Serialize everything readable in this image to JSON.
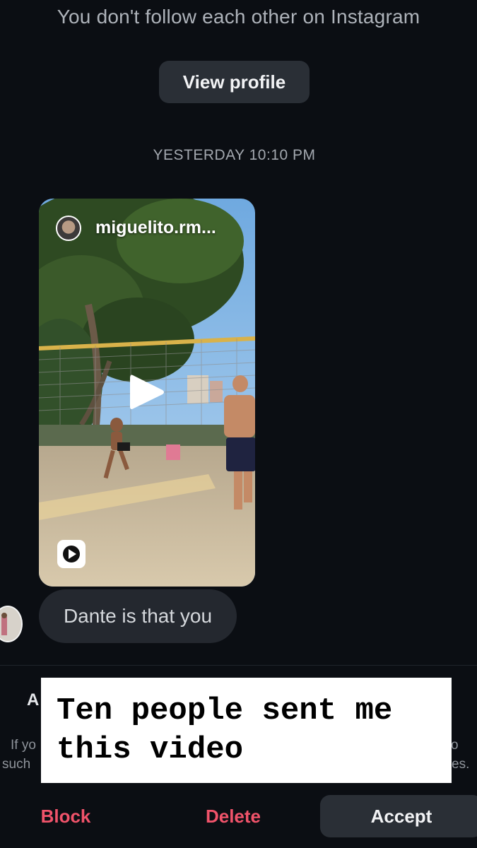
{
  "header": {
    "subtitle": "You don't follow each other on Instagram",
    "view_profile_label": "View profile"
  },
  "thread": {
    "timestamp": "YESTERDAY 10:10 PM",
    "shared_reel": {
      "author": "miguelito.rm..."
    },
    "message": "Dante is that you"
  },
  "request_panel": {
    "title_fragment": "A",
    "line1_left": "If yo",
    "line1_right": "o",
    "line2_left": "such",
    "line2_right": "es."
  },
  "overlay": {
    "caption": "Ten people sent me this video"
  },
  "actions": {
    "block": "Block",
    "delete": "Delete",
    "accept": "Accept"
  },
  "colors": {
    "background": "#0b0e13",
    "destructive": "#f0536a",
    "button_bg": "#2a2f36",
    "bubble_bg": "#24282f"
  }
}
